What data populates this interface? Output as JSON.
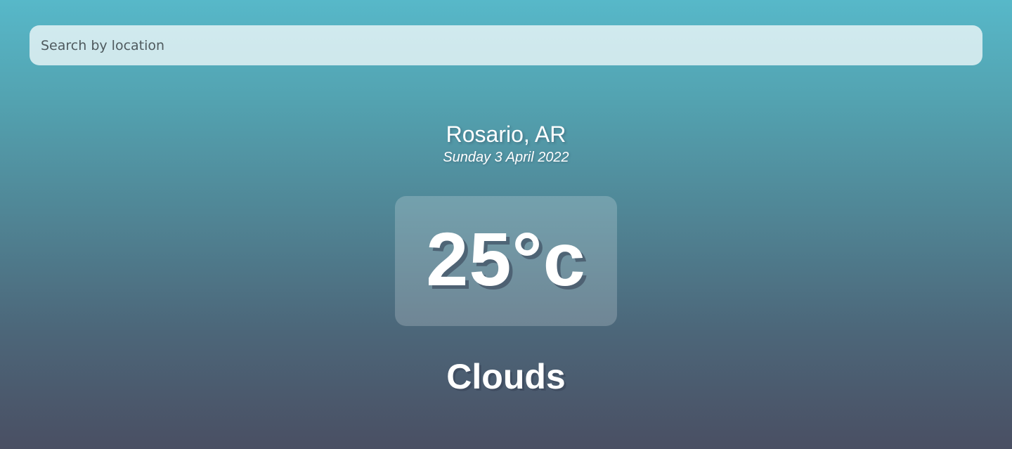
{
  "search": {
    "placeholder": "Search by location",
    "value": ""
  },
  "location": {
    "name": "Rosario, AR",
    "date": "Sunday 3 April 2022"
  },
  "weather": {
    "temperature": "25°c",
    "description": "Clouds"
  },
  "colors": {
    "gradient_top": "#57b8c9",
    "gradient_bottom": "#4a4f63",
    "text": "#ffffff"
  }
}
